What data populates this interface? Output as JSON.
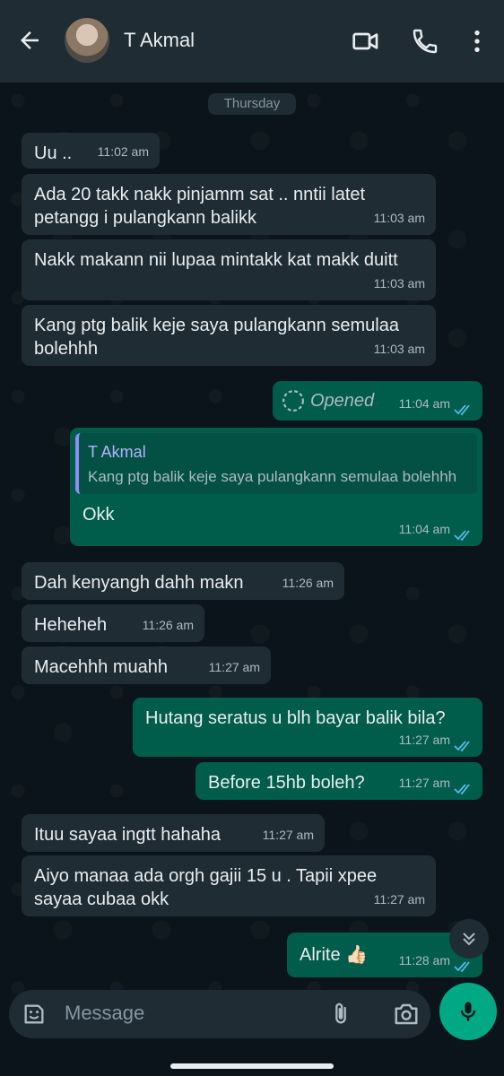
{
  "header": {
    "contact_name": "T Akmal"
  },
  "day_label": "Thursday",
  "messages": [
    {
      "dir": "in",
      "text": "Uu ..",
      "time": "11:02 am"
    },
    {
      "dir": "in",
      "text": "Ada 20 takk nakk pinjamm sat .. nntii latet petangg i pulangkann balikk",
      "time": "11:03 am"
    },
    {
      "dir": "in",
      "text": "Nakk makann nii lupaa mintakk kat makk duitt",
      "time": "11:03 am"
    },
    {
      "dir": "in",
      "text": "Kang ptg balik keje saya pulangkann semulaa bolehhh",
      "time": "11:03 am"
    },
    {
      "dir": "out",
      "text": "Opened",
      "time": "11:04 am"
    },
    {
      "dir": "out",
      "text": "Okk",
      "time": "11:04 am",
      "quote": {
        "name": "T Akmal",
        "text": "Kang ptg balik keje saya pulangkann semulaa bolehhh"
      }
    },
    {
      "dir": "in",
      "text": "Dah kenyangh dahh makn",
      "time": "11:26 am"
    },
    {
      "dir": "in",
      "text": "Heheheh",
      "time": "11:26 am"
    },
    {
      "dir": "in",
      "text": "Macehhh muahh",
      "time": "11:27 am"
    },
    {
      "dir": "out",
      "text": "Hutang seratus u blh bayar balik bila?",
      "time": "11:27 am"
    },
    {
      "dir": "out",
      "text": "Before 15hb boleh?",
      "time": "11:27 am"
    },
    {
      "dir": "in",
      "text": "Ituu sayaa ingtt hahaha",
      "time": "11:27 am"
    },
    {
      "dir": "in",
      "text": "Aiyo manaa ada orgh gajii 15 u . Tapii xpee sayaa cubaa okk",
      "time": "11:27 am"
    },
    {
      "dir": "out",
      "text": "Alrite 👍🏻",
      "time": "11:28 am"
    }
  ],
  "composer": {
    "placeholder": "Message"
  },
  "colors": {
    "accent": "#00a884",
    "bubble_out": "#005c4b",
    "bubble_in": "#1f2c34",
    "read_ticks": "#53bdeb"
  }
}
